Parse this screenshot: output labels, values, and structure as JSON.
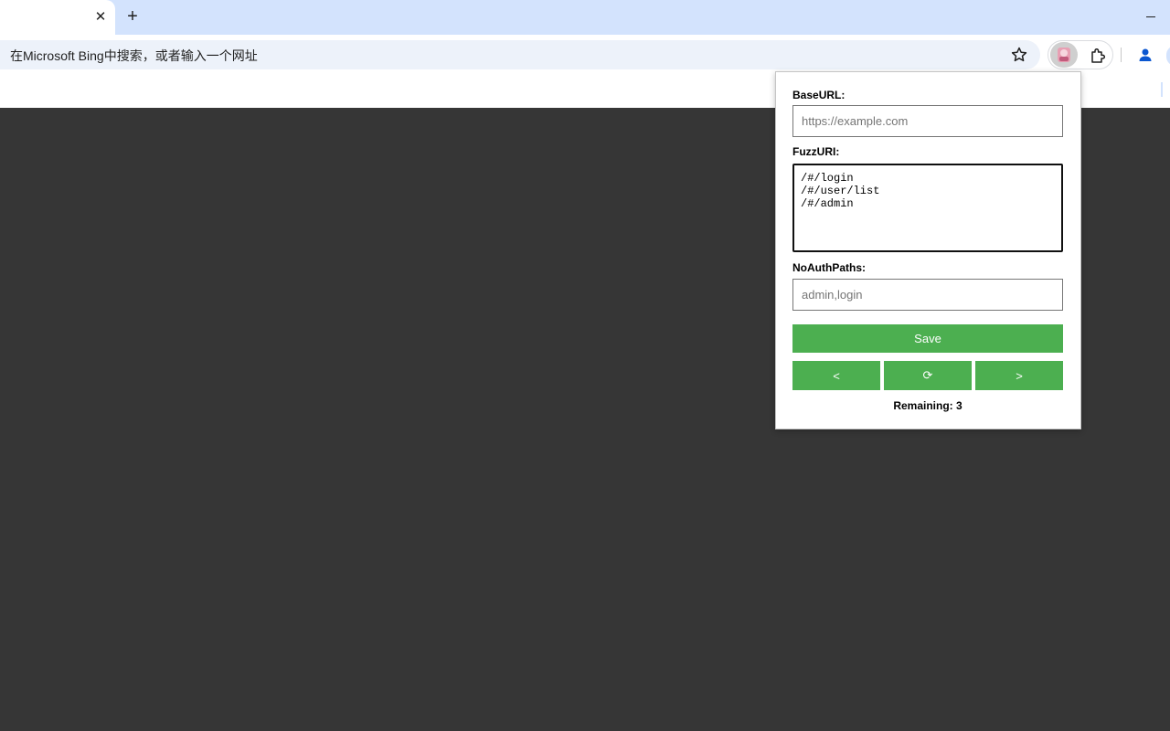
{
  "browser": {
    "tab_close": "✕",
    "new_tab": "+",
    "omnibox_placeholder": "在Microsoft Bing中搜索，或者输入一个网址"
  },
  "popup": {
    "base_url": {
      "label": "BaseURL:",
      "placeholder": "https://example.com"
    },
    "fuzz_uri": {
      "label": "FuzzURI:",
      "value": "/#/login\n/#/user/list\n/#/admin"
    },
    "no_auth_paths": {
      "label": "NoAuthPaths:",
      "placeholder": "admin,login"
    },
    "save_label": "Save",
    "prev_label": "<",
    "refresh_label": "⟳",
    "next_label": ">",
    "remaining": "Remaining: 3"
  },
  "colors": {
    "accent": "#4caf50",
    "tabstrip": "#d3e3fd",
    "content_bg": "#363636"
  },
  "icons": {
    "star": "star-icon",
    "extension_active": "extension-avatar-icon",
    "extensions": "puzzle-icon",
    "profile": "profile-icon"
  }
}
